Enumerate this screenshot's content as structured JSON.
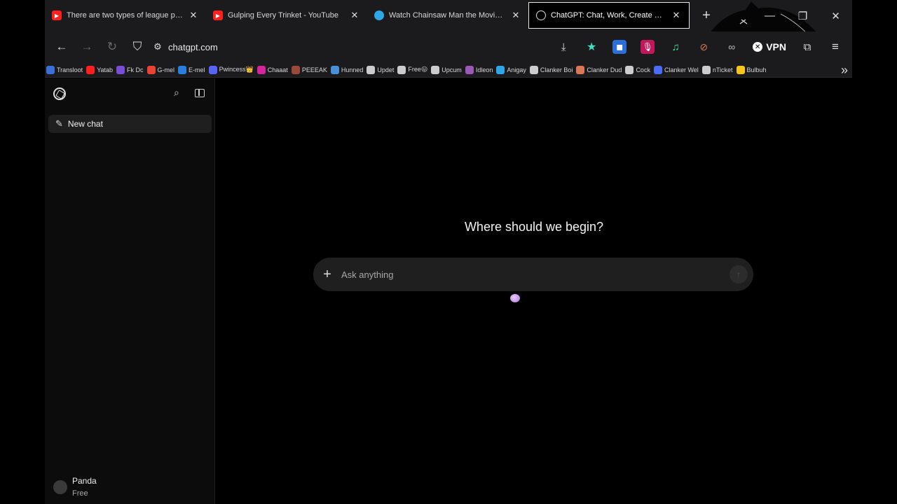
{
  "browser": {
    "tabs": [
      {
        "title": "There are two types of league players",
        "favicon": "youtube-icon",
        "active": false
      },
      {
        "title": "Gulping Every Trinket - YouTube",
        "favicon": "youtube-icon",
        "active": false
      },
      {
        "title": "Watch Chainsaw Man the Movie: Reze",
        "favicon": "crunchyroll-icon",
        "active": false
      },
      {
        "title": "ChatGPT: Chat, Work, Create & Code",
        "favicon": "chatgpt-icon",
        "active": true
      }
    ],
    "url": "chatgpt.com",
    "vpn_label": "VPN",
    "bookmarks": [
      {
        "label": "Transloot",
        "color": "#3b6fd6"
      },
      {
        "label": "Yatab",
        "color": "#ff1f1f"
      },
      {
        "label": "Fk Dc",
        "color": "#7b4dd6"
      },
      {
        "label": "G-mel",
        "color": "#ea4335"
      },
      {
        "label": "E-mel",
        "color": "#2a7de1"
      },
      {
        "label": "Pwincess👑",
        "color": "#5865f2"
      },
      {
        "label": "Chaaat",
        "color": "#d6249f"
      },
      {
        "label": "PEEEAK",
        "color": "#9b4a3a"
      },
      {
        "label": "Hunned",
        "color": "#4a90d9"
      },
      {
        "label": "Updet",
        "color": "#cccccc"
      },
      {
        "label": "Free😛",
        "color": "#cccccc"
      },
      {
        "label": "Upcum",
        "color": "#cccccc"
      },
      {
        "label": "Idleon",
        "color": "#9b59b6"
      },
      {
        "label": "Anigay",
        "color": "#2ea6e8"
      },
      {
        "label": "Clanker Boi",
        "color": "#cccccc"
      },
      {
        "label": "Clanker Dud",
        "color": "#d97757"
      },
      {
        "label": "Cock",
        "color": "#cccccc"
      },
      {
        "label": "Clanker Wel",
        "color": "#4a6cf7"
      },
      {
        "label": "nTicket",
        "color": "#cccccc"
      },
      {
        "label": "Bulbuh",
        "color": "#f5c518"
      }
    ]
  },
  "sidebar": {
    "new_chat_label": "New chat",
    "user_name": "Panda",
    "user_plan": "Free"
  },
  "main": {
    "heading": "Where should we begin?",
    "composer_placeholder": "Ask anything"
  }
}
